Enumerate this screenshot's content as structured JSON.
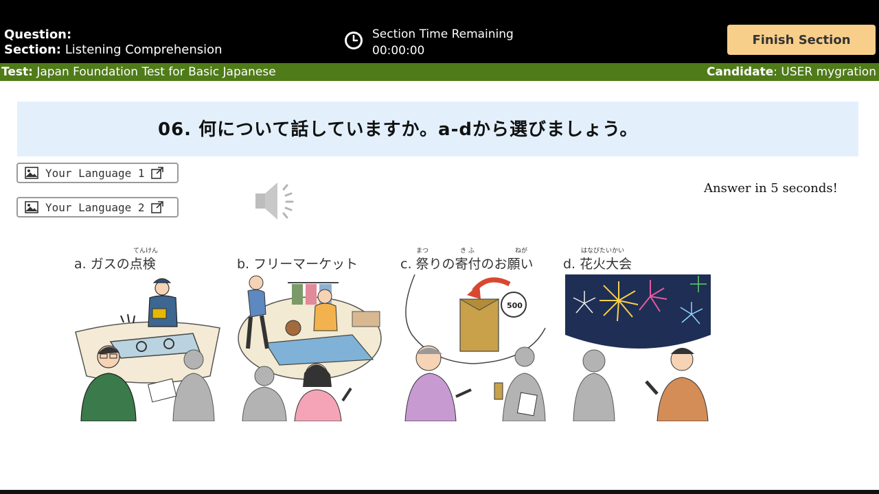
{
  "header": {
    "question_label": "Question:",
    "section_key": "Section:",
    "section_value": "Listening Comprehension",
    "timer_title": "Section Time Remaining",
    "timer_value": "00:00:00",
    "finish_label": "Finish Section"
  },
  "infobar": {
    "test_key": "Test:",
    "test_value": "Japan Foundation Test for Basic Japanese",
    "candidate_key": "Candidate",
    "candidate_value": ": USER mygration"
  },
  "question": {
    "text": "06. 何について話していますか。a-dから選びましょう。"
  },
  "language_buttons": [
    {
      "label": "Your Language 1"
    },
    {
      "label": "Your Language 2"
    }
  ],
  "audio": {
    "icon": "speaker-icon"
  },
  "answer_hint": "Answer in 5 seconds!",
  "choices": [
    {
      "label": "a. ガスの点検",
      "ruby": "てんけん"
    },
    {
      "label": "b. フリーマーケット"
    },
    {
      "label": "c. 祭りの寄付のお願い",
      "ruby1": "まつ",
      "ruby2": "き ふ",
      "ruby3": "ねが"
    },
    {
      "label": "d. 花火大会",
      "ruby": "はなびたいかい"
    }
  ],
  "colors": {
    "topbar": "#000000",
    "greenbar": "#4f7b19",
    "finish_button": "#f8cf8a",
    "question_box": "#e3f0fc"
  }
}
